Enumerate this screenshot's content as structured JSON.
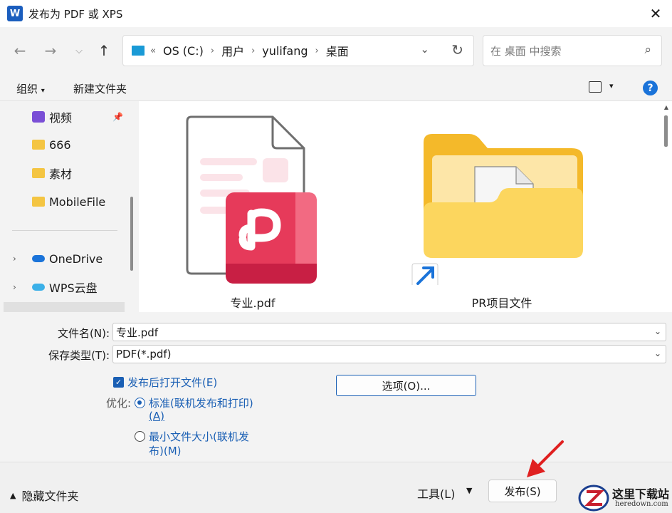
{
  "window": {
    "title": "发布为 PDF 或 XPS",
    "app_icon": "W"
  },
  "address": {
    "overflow": "«",
    "crumbs": [
      "OS (C:)",
      "用户",
      "yulifang",
      "桌面"
    ]
  },
  "search": {
    "placeholder": "在 桌面 中搜索"
  },
  "toolbar": {
    "organize": "组织",
    "new_folder": "新建文件夹",
    "help": "?"
  },
  "nav": {
    "items": [
      {
        "label": "视频"
      },
      {
        "label": "666"
      },
      {
        "label": "素材"
      },
      {
        "label": "MobileFile"
      },
      {
        "label": "OneDrive"
      },
      {
        "label": "WPS云盘"
      }
    ]
  },
  "files": [
    {
      "name": "专业.pdf"
    },
    {
      "name": "PR项目文件"
    }
  ],
  "form": {
    "filename_label": "文件名(N):",
    "filename_value": "专业.pdf",
    "filetype_label": "保存类型(T):",
    "filetype_value": "PDF(*.pdf)",
    "open_after_label": "发布后打开文件(E)",
    "optimize_label": "优化:",
    "standard_line1": "标准(联机发布和打印)",
    "standard_line2": "(A)",
    "minimum_line1": "最小文件大小(联机发",
    "minimum_line2": "布)(M)",
    "options_button": "选项(O)..."
  },
  "footer": {
    "hide_folders": "隐藏文件夹",
    "tools": "工具(L)",
    "publish": "发布(S)"
  },
  "watermark": {
    "title": "这里下载站",
    "url": "heredown.com"
  },
  "colors": {
    "accent": "#1a5fb4",
    "folder": "#f4c542",
    "pdf_red": "#e63a5a"
  }
}
